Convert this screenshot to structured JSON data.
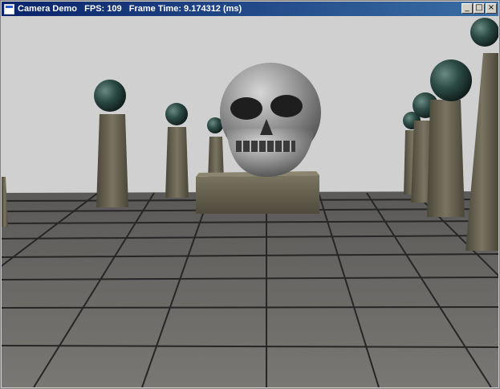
{
  "window": {
    "title": "Camera Demo   FPS: 109   Frame Time: 9.174312 (ms)",
    "controls": {
      "minimize": "_",
      "maximize": "□",
      "close": "×"
    }
  },
  "scene": {
    "background_color": "#d0d0d0",
    "floor_color": "#6e6c6a",
    "grout_color": "#2a2a2a",
    "sphere_color": "#2c4a44",
    "column_color": "#6a6552",
    "skull_color": "#8a8a8a"
  }
}
